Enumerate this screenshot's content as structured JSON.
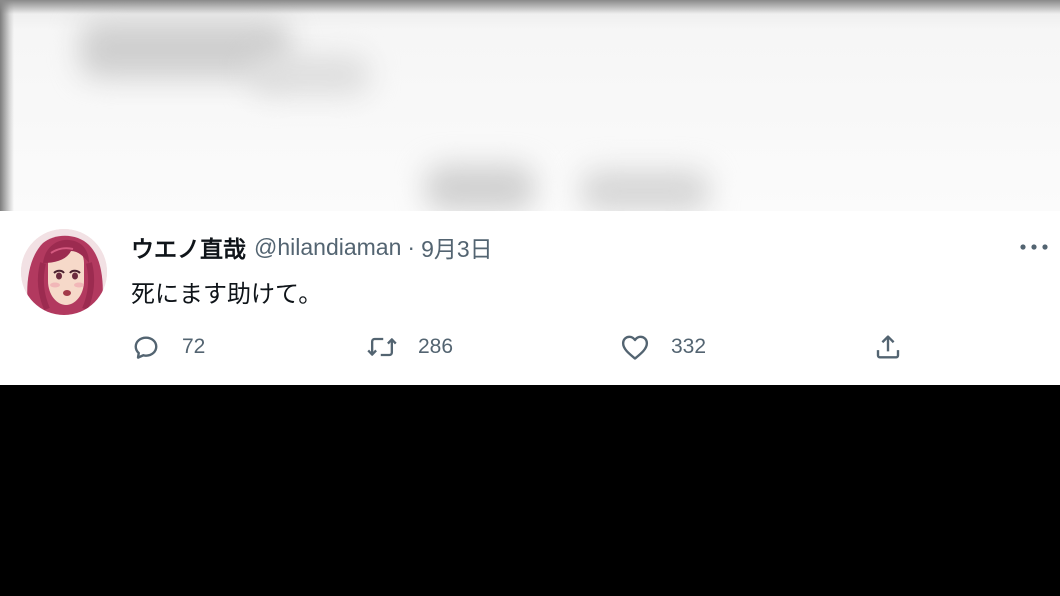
{
  "tweet": {
    "display_name": "ウエノ直哉",
    "handle": "@hilandiaman",
    "separator": "·",
    "date": "9月3日",
    "text": "死にます助けて。",
    "avatar_icon": "profile-avatar",
    "more_icon": "more-options-icon"
  },
  "actions": {
    "reply": {
      "icon": "reply-icon",
      "count": "72"
    },
    "retweet": {
      "icon": "retweet-icon",
      "count": "286"
    },
    "like": {
      "icon": "heart-icon",
      "count": "332"
    },
    "share": {
      "icon": "share-icon"
    }
  },
  "colors": {
    "text_primary": "#0f1419",
    "text_secondary": "#536471",
    "background": "#ffffff"
  }
}
